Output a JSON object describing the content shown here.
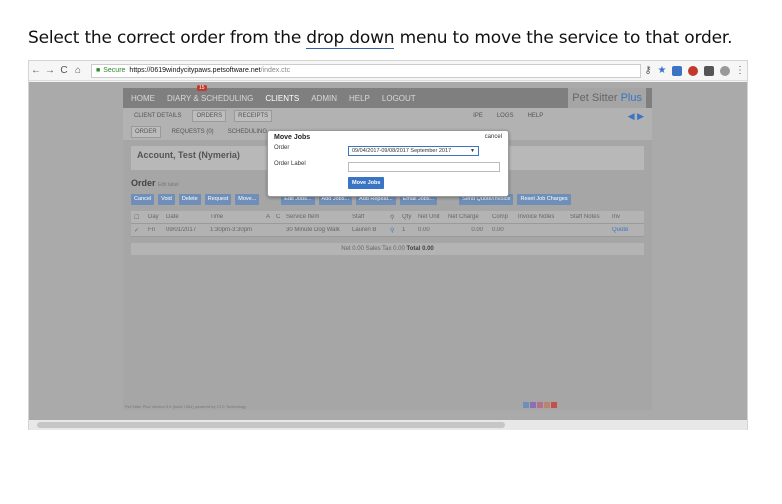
{
  "instruction": {
    "pre": "Select the correct order from the ",
    "link": "drop down",
    "post": " menu to move the service to that order."
  },
  "browser": {
    "secure_label": "Secure",
    "url_host": "https://0619windycitypaws.petsoftware.net",
    "url_path": "/index.ctc"
  },
  "app": {
    "topnav": [
      "HOME",
      "DIARY & SCHEDULING",
      "CLIENTS",
      "ADMIN",
      "HELP",
      "LOGOUT"
    ],
    "badge": "15",
    "brand_main": "Pet Sitter",
    "brand_plus": "Plus",
    "subnav_row1": [
      "CLIENT DETAILS",
      "ORDERS",
      "RECEIPTS"
    ],
    "subnav_row1_right": [
      "IPE",
      "LOGS",
      "HELP"
    ],
    "subnav_row2": [
      "ORDER",
      "REQUESTS (0)",
      "SCHEDULING"
    ],
    "account_title": "Account, Test (Nymeria)",
    "order_heading": "Order",
    "edit_label": "Edit label",
    "actions": [
      "Cancel",
      "Void",
      "Delete",
      "Request",
      "Move...",
      "Edit Jobs...",
      "Add Jobs...",
      "Add Repeat...",
      "Email Jobs...",
      "Send Quote/Invoice",
      "Reset Job Charges"
    ],
    "table_headers": [
      "",
      "Day",
      "Date",
      "Time",
      "A",
      "C",
      "Service Item",
      "Staff",
      "",
      "Qty",
      "Net Unit",
      "Net Charge",
      "Comp",
      "Invoice Notes",
      "Staff Notes",
      "Inv"
    ],
    "rows": [
      [
        "✓",
        "Fri",
        "09/01/2017",
        "1:30pm-3:30pm",
        "",
        "",
        "30 Minute Dog Walk",
        "Lauren B",
        "",
        "1",
        "0.00",
        "0.00",
        "0.00",
        "",
        "",
        "Quote"
      ]
    ],
    "totals_pre": "Net 0.00 Sales Tax 0.00 ",
    "totals_bold": "Total 0.00",
    "footer": "Pet Sitter Plus Version 5.6 (build 7264) powered by CTC Technology"
  },
  "modal": {
    "title": "Move Jobs",
    "cancel": "cancel",
    "order_label": "Order",
    "order_value": "09/04/2017-09/08/2017 September 2017",
    "order_label2": "Order Label",
    "order_label2_value": "",
    "move_button": "Move Jobs"
  },
  "colors": {
    "accent": "#3a74c4",
    "overlay": "#aaaaaa",
    "swatches": [
      "#6f8fb8",
      "#8a6fb8",
      "#b86f8a",
      "#b8866f",
      "#c0504d"
    ]
  }
}
